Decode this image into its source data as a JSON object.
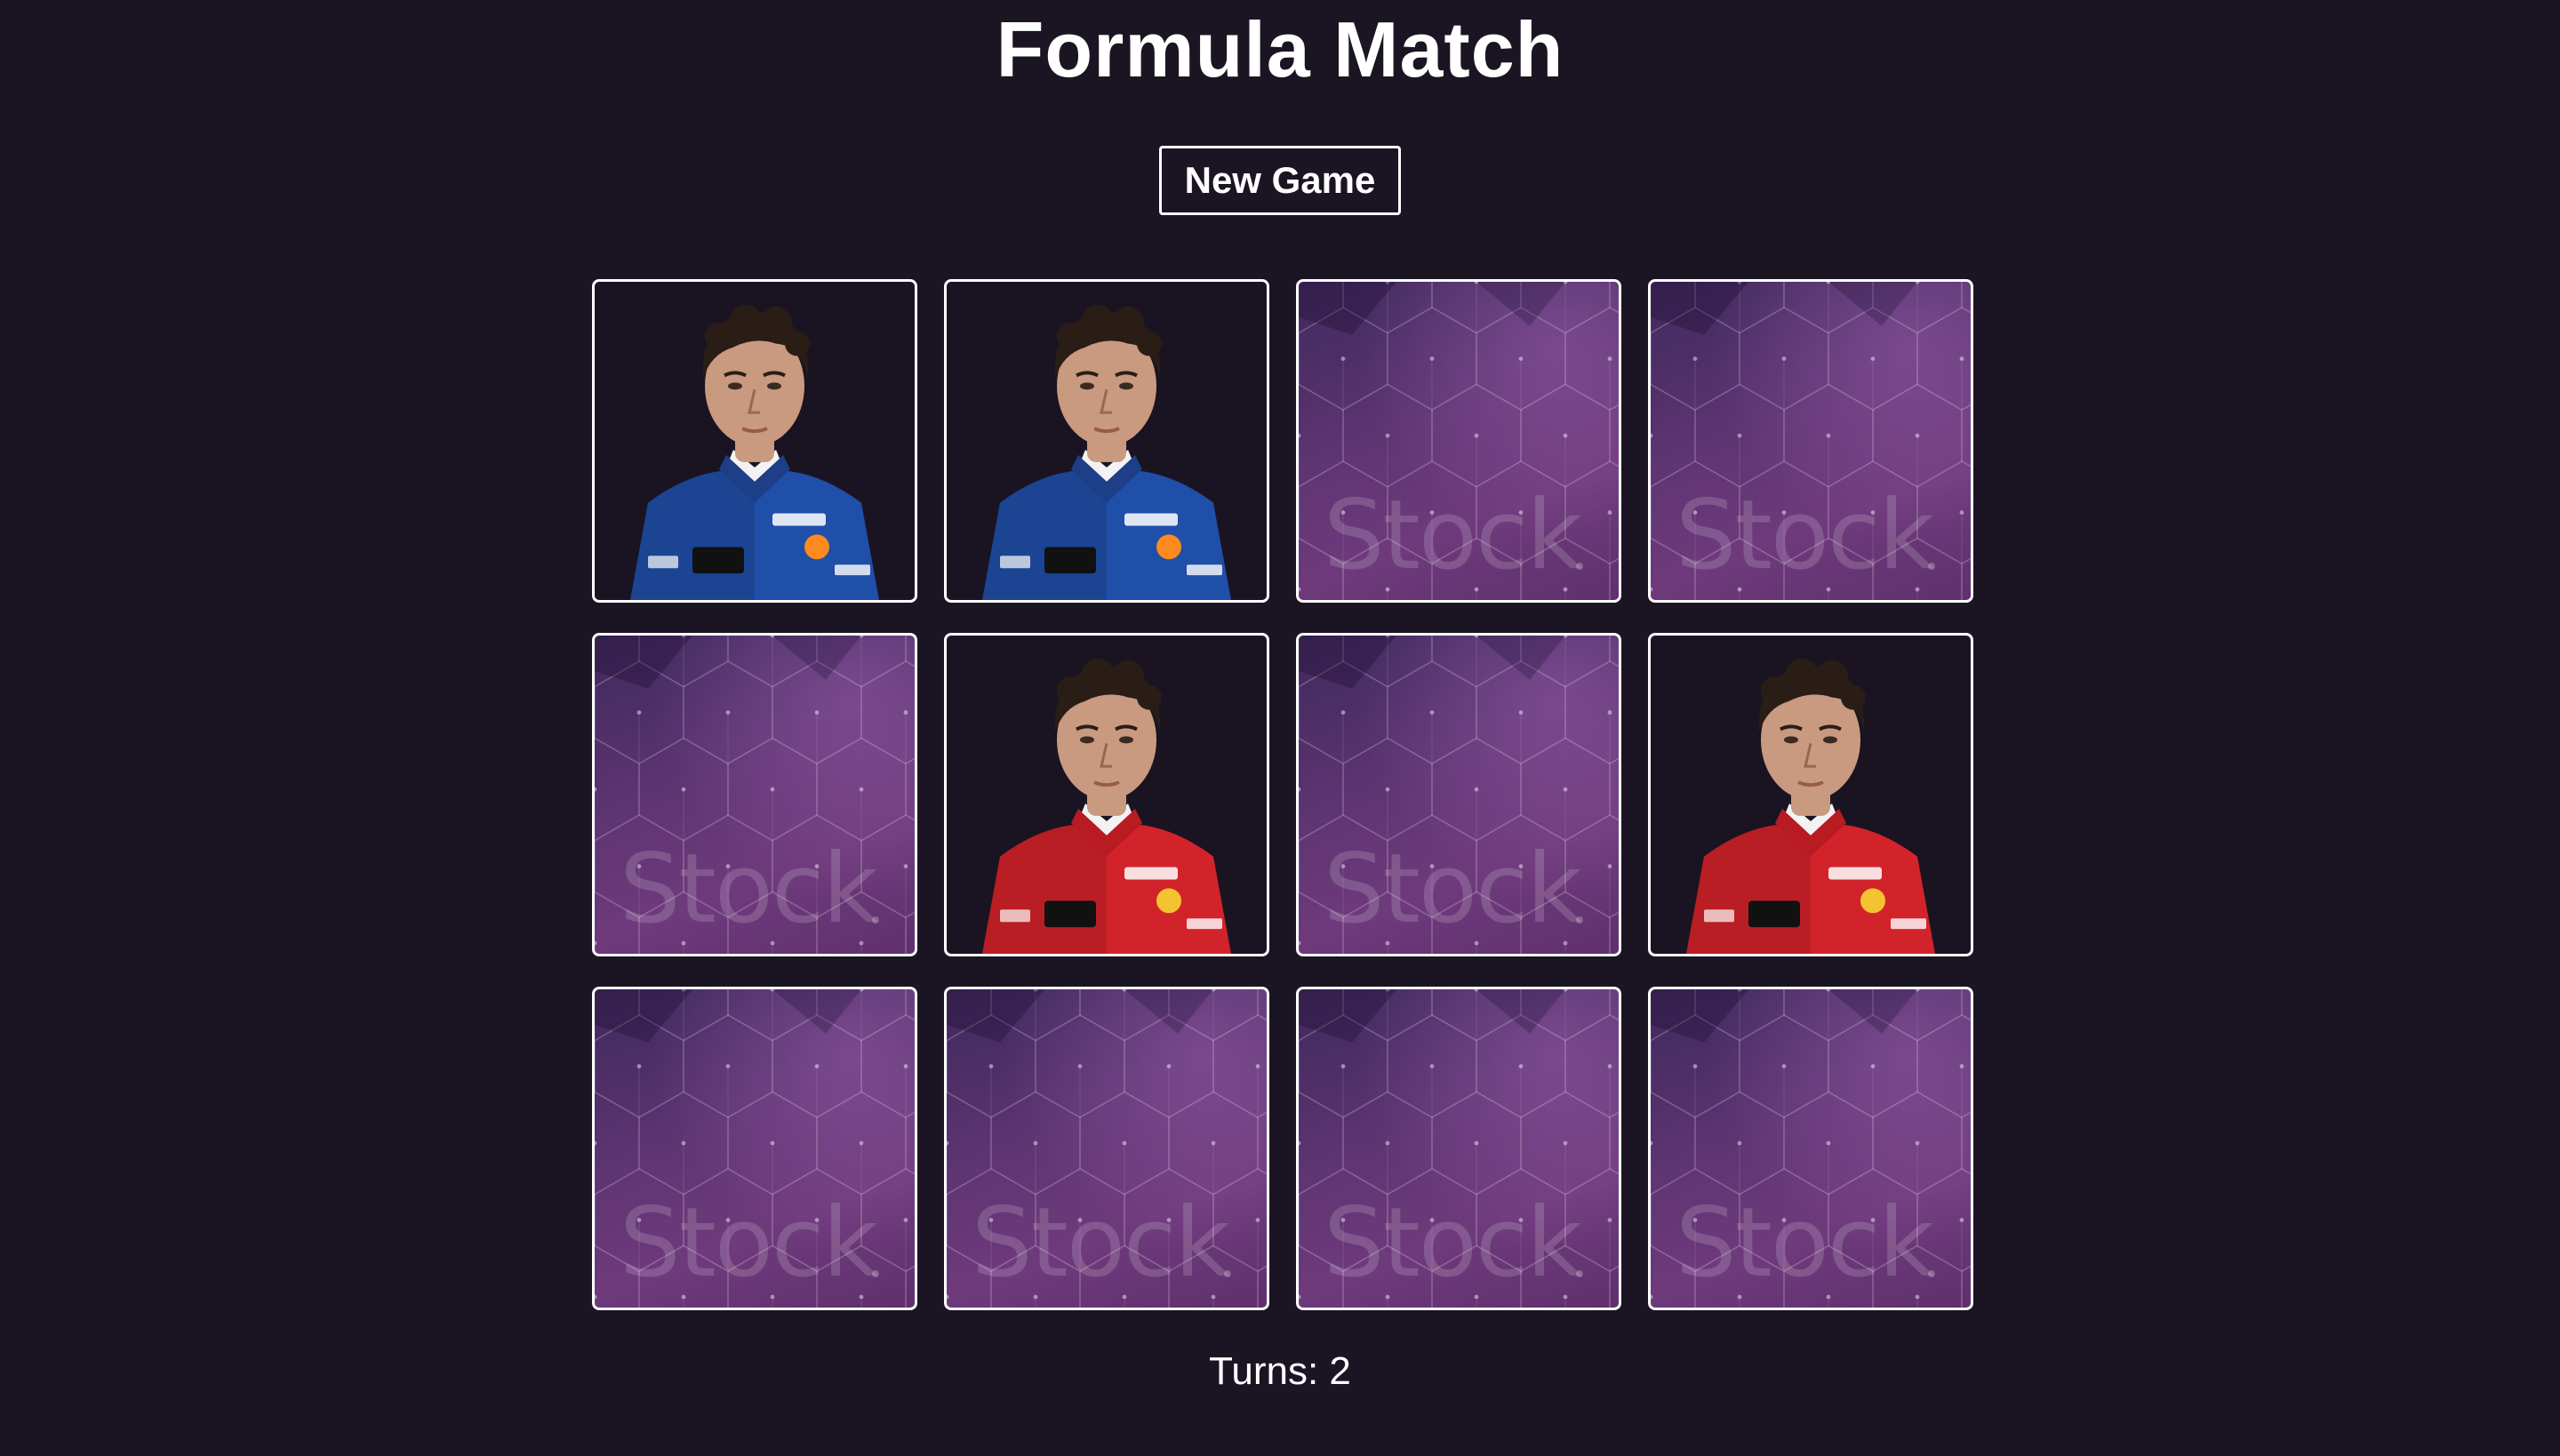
{
  "title": "Formula Match",
  "new_game_label": "New Game",
  "card_back_watermark": "Stock",
  "cards": [
    {
      "state": "revealed",
      "driver": "mclaren-driver",
      "team_color": "#1f4fa8"
    },
    {
      "state": "revealed",
      "driver": "mclaren-driver",
      "team_color": "#1f4fa8"
    },
    {
      "state": "hidden"
    },
    {
      "state": "hidden"
    },
    {
      "state": "hidden"
    },
    {
      "state": "revealed",
      "driver": "ferrari-driver",
      "team_color": "#d3232a"
    },
    {
      "state": "hidden"
    },
    {
      "state": "revealed",
      "driver": "ferrari-driver",
      "team_color": "#d3232a"
    },
    {
      "state": "hidden"
    },
    {
      "state": "hidden"
    },
    {
      "state": "hidden"
    },
    {
      "state": "hidden"
    }
  ],
  "turns": {
    "label": "Turns:",
    "value": 2
  },
  "colors": {
    "background": "#1b1523",
    "card_back": "#5b2f70",
    "border": "#ffffff"
  }
}
